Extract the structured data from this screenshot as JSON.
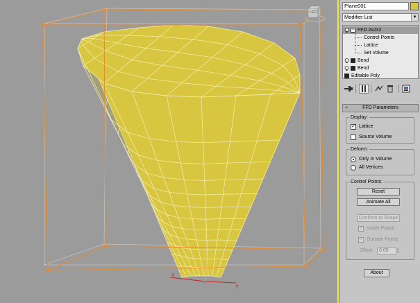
{
  "viewport": {
    "viewcube_label": "LEFT",
    "colors": {
      "surface": "#d8c640",
      "surface_dark": "#b3a435",
      "wire": "#f4efb4",
      "lattice": "#e88a2c",
      "bbox": "#e8e8e8",
      "highlight_border": "#f2e94e"
    },
    "axis_labels": {
      "x": "x",
      "y": "y"
    }
  },
  "panel": {
    "object_name": "Plane001",
    "object_color": "#d8c640",
    "modifier_list_label": "Modifier List",
    "stack": [
      {
        "label": "FFD 2x2x2",
        "selected": true,
        "sub_objects": [
          "Control Points",
          "Lattice",
          "Set Volume"
        ]
      },
      {
        "label": "Bend"
      },
      {
        "label": "Bend"
      },
      {
        "label": "Editable Poly"
      }
    ],
    "toolbar_icons": [
      "pin-stack-icon",
      "show-end-result-icon",
      "make-unique-icon",
      "remove-modifier-icon",
      "configure-sets-icon"
    ],
    "rollout_title": "FFD Parameters",
    "display": {
      "label": "Display:",
      "lattice": {
        "label": "Lattice",
        "checked": true
      },
      "source_volume": {
        "label": "Source Volume",
        "checked": false
      }
    },
    "deform": {
      "label": "Deform:",
      "only_in_volume": "Only In Volume",
      "all_vertices": "All Vertices",
      "selected": "only_in_volume"
    },
    "control_points": {
      "label": "Control Points:",
      "reset": "Reset",
      "animate_all": "Animate All",
      "conform": "Conform to Shape",
      "inside_points": "Inside Points",
      "outside_points": "Outside Points",
      "offset_label": "Offset:",
      "offset_value": "0,05"
    },
    "about": "About"
  }
}
